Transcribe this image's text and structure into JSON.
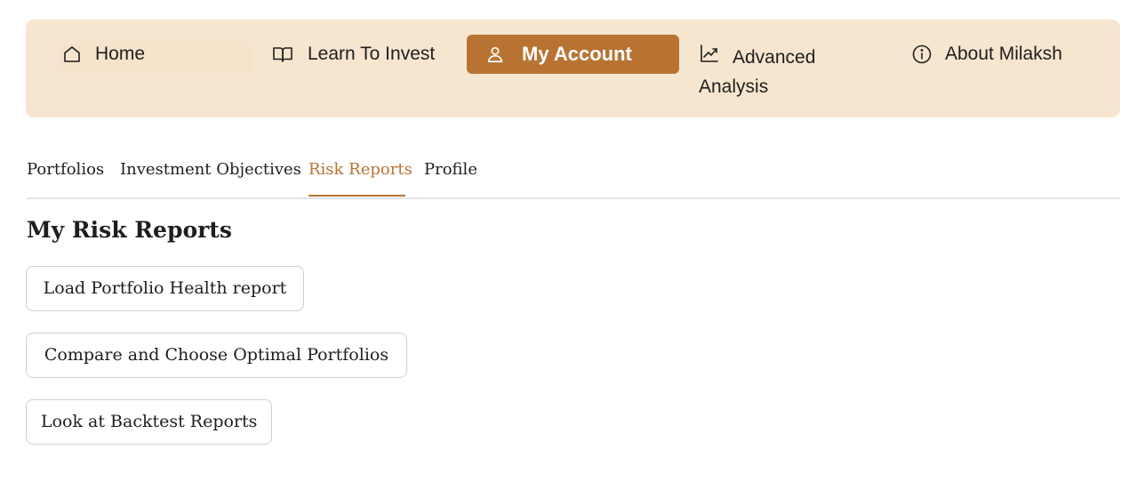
{
  "nav": {
    "items": [
      {
        "label": "Home",
        "icon": "home-icon"
      },
      {
        "label": "Learn To Invest",
        "icon": "book-icon"
      },
      {
        "label": "My Account",
        "icon": "user-icon",
        "active": true
      },
      {
        "label": "Advanced Analysis",
        "icon": "trend-chart-icon"
      },
      {
        "label": "About Milaksh",
        "icon": "info-icon"
      }
    ]
  },
  "tabs": {
    "items": [
      {
        "label": "Portfolios"
      },
      {
        "label": "Investment Objectives"
      },
      {
        "label": "Risk Reports",
        "active": true
      },
      {
        "label": "Profile"
      }
    ]
  },
  "main": {
    "title": "My Risk Reports",
    "actions": [
      {
        "label": "Load Portfolio Health report"
      },
      {
        "label": "Compare and Choose Optimal Portfolios"
      },
      {
        "label": "Look at Backtest Reports"
      }
    ]
  },
  "colors": {
    "nav_background": "#f7e6cf",
    "accent": "#b87333",
    "text": "#1e1e1e",
    "divider": "#e3e3e3",
    "button_border": "#cfcfcf"
  }
}
